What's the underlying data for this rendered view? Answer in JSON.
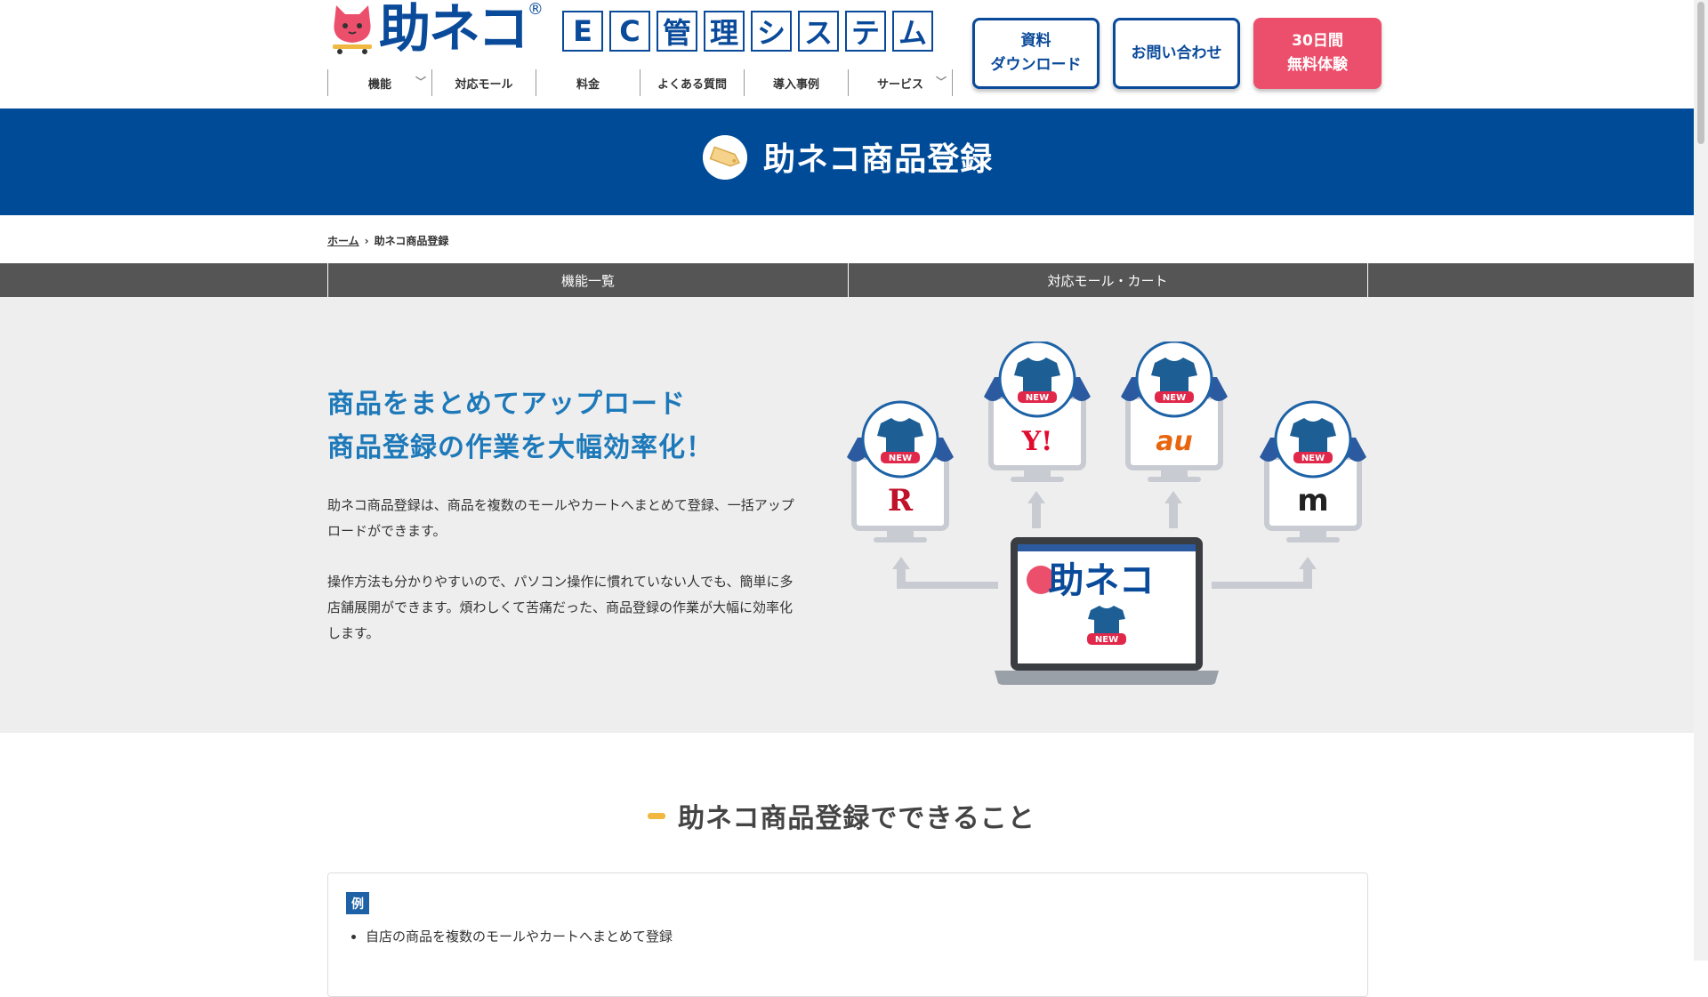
{
  "header": {
    "logo_text": "助ネコ",
    "logo_reg": "®",
    "ec_chars": [
      "E",
      "C",
      "管",
      "理",
      "シ",
      "ス",
      "テ",
      "ム"
    ],
    "nav": [
      {
        "label": "機能",
        "dropdown": true
      },
      {
        "label": "対応モール",
        "dropdown": false
      },
      {
        "label": "料金",
        "dropdown": false
      },
      {
        "label": "よくある質問",
        "dropdown": false
      },
      {
        "label": "導入事例",
        "dropdown": false
      },
      {
        "label": "サービス",
        "dropdown": true
      }
    ],
    "btn_doc": "資料\nダウンロード",
    "btn_inquiry": "お問い合わせ",
    "btn_trial": "30日間\n無料体験"
  },
  "banner": {
    "title": "助ネコ商品登録",
    "icon": "price-tag-icon"
  },
  "breadcrumb": {
    "home": "ホーム",
    "current": "助ネコ商品登録"
  },
  "subtabs": [
    "機能一覧",
    "対応モール・カート"
  ],
  "intro": {
    "heading_line1": "商品をまとめてアップロード",
    "heading_line2": "商品登録の作業を大幅効率化！",
    "p1": "助ネコ商品登録は、商品を複数のモールやカートへまとめて登録、一括アップロードができます。",
    "p2": "操作方法も分かりやすいので、パソコン操作に慣れていない人でも、簡単に多店舗展開ができます。煩わしくて苦痛だった、商品登録の作業が大幅に効率化します。",
    "illus_badge": "NEW",
    "illus_store_logos": [
      "R",
      "Y!",
      "au",
      "m"
    ],
    "illus_laptop_logo": "助ネコ"
  },
  "section": {
    "title": "助ネコ商品登録でできること",
    "badge": "例",
    "items": [
      "自店の商品を複数のモールやカートへまとめて登録"
    ]
  },
  "colors": {
    "brand_blue": "#004b98",
    "accent_pink": "#ec4f6b",
    "heading_blue": "#1d79b9"
  }
}
